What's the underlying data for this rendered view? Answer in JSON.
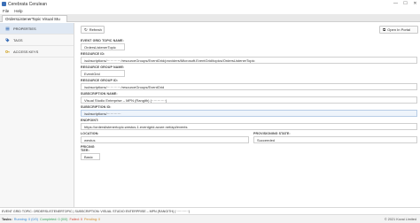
{
  "window": {
    "title": "Cerebrata Cerulean",
    "controls": [
      "—",
      "☐",
      "✕"
    ]
  },
  "menu": {
    "file": "File",
    "help": "Help"
  },
  "tab": {
    "title": "OrdersListenerTopic Visual Stu"
  },
  "sidebar": {
    "items": [
      {
        "label": "PROPERTIES",
        "icon": "properties-icon"
      },
      {
        "label": "TAGS",
        "icon": "tag-icon"
      },
      {
        "label": "ACCESS KEYS",
        "icon": "key-icon"
      }
    ]
  },
  "toolbar": {
    "refresh_label": "Refresh",
    "portal_label": "Open In Portal"
  },
  "fields": {
    "topic_name": {
      "label": "EVENT GRID TOPIC NAME:",
      "value": "OrdersListenerTopic"
    },
    "resource_id": {
      "label": "RESOURCE ID:",
      "value": "/subscriptions/············/resourceGroups/EventGrid/providers/Microsoft.EventGrid/topics/OrdersListenerTopic"
    },
    "resource_group": {
      "label": "RESOURCE GROUP NAME:",
      "value": "EventGrid"
    },
    "resource_group_id": {
      "label": "RESOURCE GROUP ID:",
      "value": "/subscriptions/············/resourceGroups/EventGrid"
    },
    "subscription_name": {
      "label": "SUBSCRIPTION NAME:",
      "value": "Visual Studio Enterprise – MPN (Rangith) (············)"
    },
    "subscription_id": {
      "label": "SUBSCRIPTION ID:",
      "value": "/subscriptions/············"
    },
    "endpoint": {
      "label": "ENDPOINT:",
      "value": "https://orderslistenertopic.westus-1.eventgrid.azure.net/api/events"
    },
    "location": {
      "label": "LOCATION:",
      "value": "westus"
    },
    "provisioning": {
      "label": "PROVISIONING STATE:",
      "value": "Succeeded"
    },
    "pricing": {
      "label": "PRICING TIER:",
      "value": "Basic"
    }
  },
  "statusline": {
    "text": "EVENT GRID TOPIC: ORDERSLISTENERTOPIC | SUBSCRIPTION: VISUAL STUDIO ENTERPRISE – MPN (RANGITH) (············)"
  },
  "taskbar": {
    "label": "Tasks:",
    "running": "Running: 0 (0/0)",
    "completed": "Completed: 0 (0/0)",
    "failed": "Failed: 0",
    "pending": "Pending: 0",
    "copyright": "© 2021 Kovai Limited"
  },
  "colors": {
    "accent": "#3b6fb6",
    "active_sidebar": "#dfe8f3",
    "running": "#3a8ad6",
    "completed": "#3aa35c",
    "failed": "#d24a3a",
    "pending": "#d28a2a"
  }
}
